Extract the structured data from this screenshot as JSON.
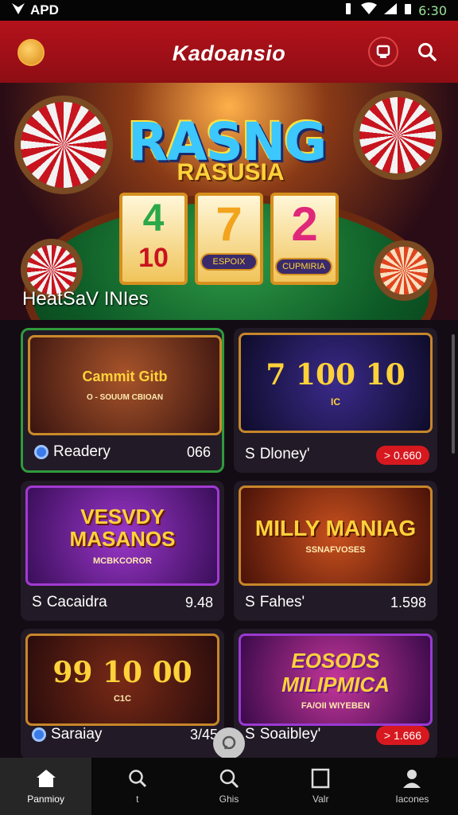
{
  "status": {
    "carrier": "APD",
    "time": "6:30"
  },
  "appbar": {
    "title": "Kadoansio"
  },
  "hero": {
    "brand_top": "RASNG",
    "brand_sub": "RASUSIA",
    "reel1_top": "4",
    "reel1_bottom": "10",
    "reel2_top": "7",
    "reel3_top": "2",
    "badge_left": "ESPOIX",
    "badge_right": "CUPMIRIA",
    "caption": "HeatSaV INIes"
  },
  "cards": [
    {
      "name": "Readery",
      "value": "066",
      "thumb_text": "Cammit Gitb",
      "thumb_sub": "O - SOUUM CBIOAN"
    },
    {
      "name": "Dloney'",
      "value": "> 0.660",
      "thumb_text": "7  100  10",
      "thumb_sub": "IC"
    },
    {
      "name": "Cacaidra",
      "value": "9.48",
      "thumb_text": "VESVDY MASANOS",
      "thumb_sub": "MCBKCOROR"
    },
    {
      "name": "Fahes'",
      "value": "1.598",
      "thumb_text": "MILLY MANIAG",
      "thumb_sub": "SSNAFVOSES"
    },
    {
      "name": "Saraiay",
      "value": "3/45",
      "thumb_text": "99  10  00",
      "thumb_sub": "C1C"
    },
    {
      "name": "Soaibley'",
      "value": "> 1.666",
      "thumb_text": "EOSODS MILIPMICA",
      "thumb_sub": "FA/OII WIYEBEN"
    }
  ],
  "nav": [
    {
      "label": "Panmioy",
      "icon": "home-icon"
    },
    {
      "label": "t",
      "icon": "search-icon"
    },
    {
      "label": "Ghis",
      "icon": "search-icon"
    },
    {
      "label": "Valr",
      "icon": "square-icon"
    },
    {
      "label": "Iacones",
      "icon": "user-icon"
    }
  ],
  "colors": {
    "accent": "#b4121b",
    "card": "#221a26",
    "pill": "#d7191f"
  }
}
